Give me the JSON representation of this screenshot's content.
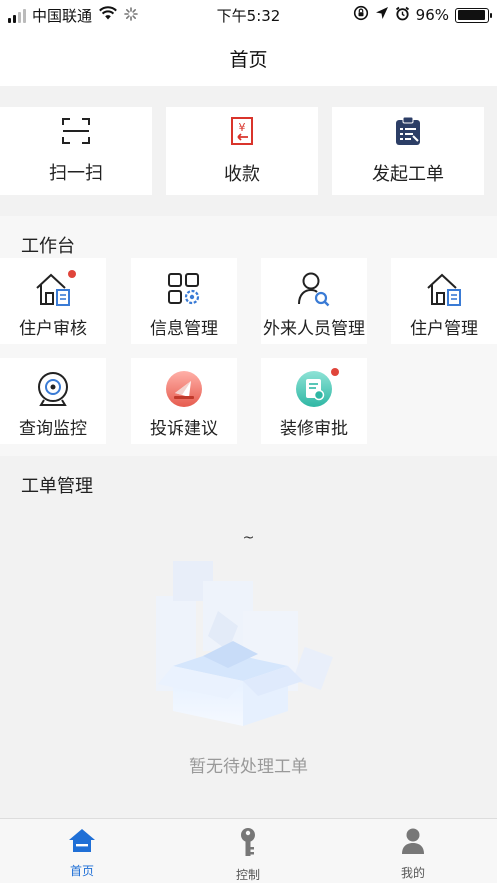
{
  "status_bar": {
    "carrier": "中国联通",
    "time": "下午5:32",
    "battery": "96%",
    "battery_level": 0.96,
    "icons": [
      "signal-icon",
      "wifi-icon",
      "loading-icon",
      "rotation-lock-icon",
      "location-icon",
      "alarm-icon",
      "battery-icon"
    ]
  },
  "header": {
    "title": "首页"
  },
  "quick_actions": [
    {
      "label": "扫一扫",
      "icon": "scan-icon"
    },
    {
      "label": "收款",
      "icon": "receipt-yen-icon"
    },
    {
      "label": "发起工单",
      "icon": "clipboard-wrench-icon"
    }
  ],
  "workspace": {
    "title": "工作台",
    "items": [
      {
        "label": "住户审核",
        "icon": "house-document-icon",
        "badge": true
      },
      {
        "label": "信息管理",
        "icon": "grid-gear-icon",
        "badge": false
      },
      {
        "label": "外来人员管理",
        "icon": "person-search-icon",
        "badge": false
      },
      {
        "label": "住户管理",
        "icon": "house-document-icon",
        "badge": false
      },
      {
        "label": "查询监控",
        "icon": "camera-icon",
        "badge": false
      },
      {
        "label": "投诉建议",
        "icon": "paper-plane-icon",
        "badge": false
      },
      {
        "label": "装修审批",
        "icon": "certificate-icon",
        "badge": true
      }
    ]
  },
  "orders": {
    "title": "工单管理",
    "tilde": "~",
    "empty_text": "暂无待处理工单"
  },
  "tabbar": {
    "tabs": [
      {
        "label": "首页",
        "icon": "home-icon",
        "active": true
      },
      {
        "label": "控制",
        "icon": "key-icon",
        "active": false
      },
      {
        "label": "我的",
        "icon": "user-icon",
        "active": false
      }
    ]
  },
  "colors": {
    "accent": "#1f6fd6",
    "badge": "#e0453b",
    "icon_dark": "#2c3e66",
    "receipt_red": "#d9342b"
  }
}
